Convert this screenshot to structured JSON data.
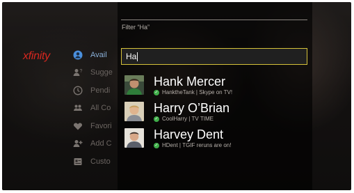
{
  "brand": {
    "logo": "xfinity"
  },
  "nav": {
    "items": [
      {
        "label": "Avail",
        "icon": "available-icon",
        "active": true
      },
      {
        "label": "Sugge",
        "icon": "suggested-icon"
      },
      {
        "label": "Pendi",
        "icon": "clock-icon"
      },
      {
        "label": "All Co",
        "icon": "contacts-icon"
      },
      {
        "label": "Favori",
        "icon": "heart-icon"
      },
      {
        "label": "Add C",
        "icon": "add-contact-icon"
      },
      {
        "label": "Custo",
        "icon": "custom-list-icon"
      }
    ]
  },
  "filter": {
    "title": "Filter “Ha”",
    "query": "Ha"
  },
  "results": [
    {
      "name": "Hank Mercer",
      "handle": "HanktheTank",
      "status": "Skype on TV!"
    },
    {
      "name": "Harry O’Brian",
      "handle": "CoolHarry",
      "status": "TV TIME"
    },
    {
      "name": "Harvey Dent",
      "handle": "HDent",
      "status": "TGIF reruns are on!"
    }
  ],
  "colors": {
    "accent_focus": "#d6c23a",
    "online_status": "#3fae49",
    "brand_red": "#d6271f",
    "nav_active": "#4a8fdc"
  }
}
